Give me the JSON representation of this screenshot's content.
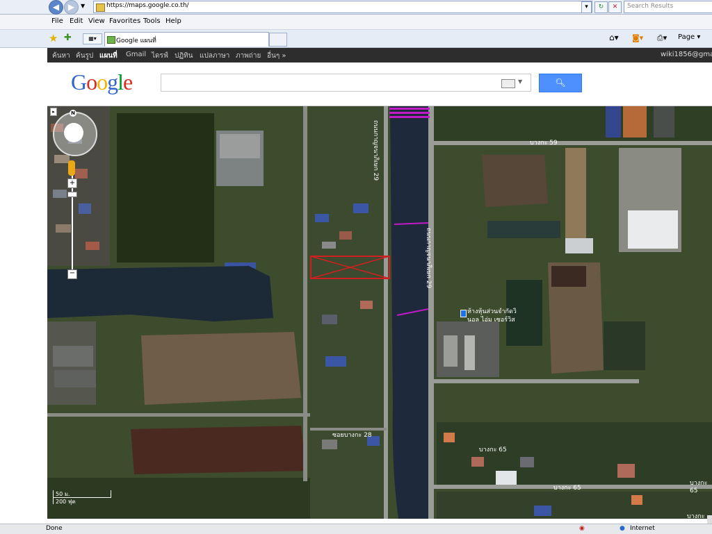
{
  "browser": {
    "url": "https://maps.google.co.th/",
    "search_placeholder": "Search Results",
    "menu": [
      "File",
      "Edit",
      "View",
      "Favorites",
      "Tools",
      "Help"
    ],
    "tab_title": "Google แผนที่",
    "toolbar_page": "Page",
    "status_left": "Done",
    "status_zone": "Internet"
  },
  "google_bar": {
    "items": [
      "ค้นหา",
      "ค้นรูป",
      "แผนที่",
      "Gmail",
      "ไดรฟ์",
      "ปฏิทิน",
      "แปลภาษา",
      "ภาพถ่าย",
      "อื่นๆ »"
    ],
    "selected_index": 2,
    "user": "wiki1856@gmai"
  },
  "google_header": {
    "logo": "Google",
    "search_value": ""
  },
  "map": {
    "road_labels": [
      "บางกะ 59",
      "ถนนกาญจนาภิเษก 29",
      "ถนนกาญจนาภิเษก 29",
      "ซอยบางกะ 28",
      "บางกะ 65",
      "บางกะ 65",
      "บางกะ 65",
      "บางกะ 65"
    ],
    "place_label_1": "ห้างหุ้นส่วนจำกัดวิ",
    "place_label_2": "นอล ไอ่ม เซอร์วิส",
    "scale_top": "50 ม.",
    "scale_bottom": "200 ฟุต",
    "compass_n": "N"
  },
  "colors": {
    "google_blue": "#4d90fe",
    "marker_red": "#d11f1f",
    "route_magenta": "#c31ac8",
    "canal": "#1e2a3c"
  }
}
